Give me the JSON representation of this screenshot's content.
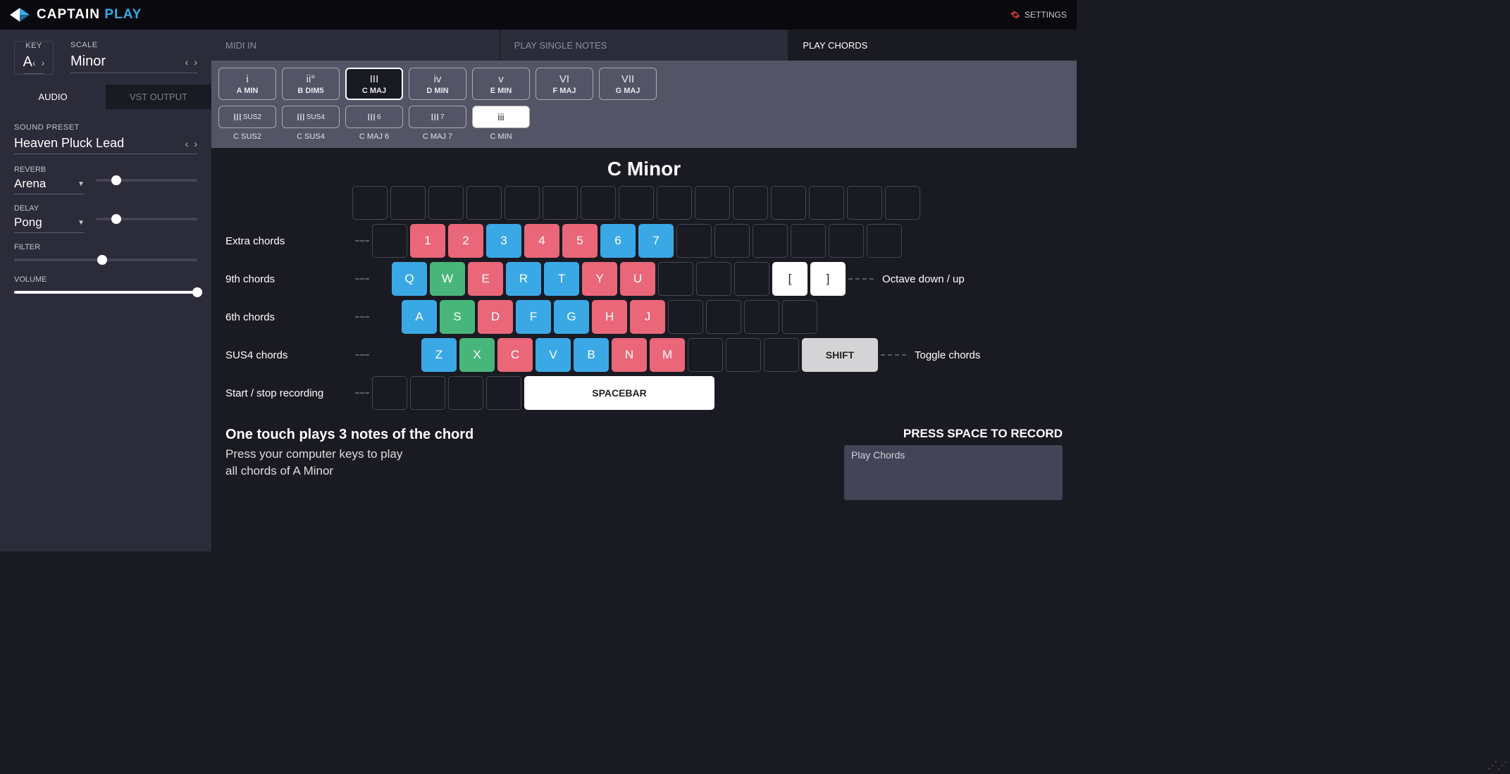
{
  "header": {
    "brand_white": "CAPTAIN",
    "brand_blue": "PLAY",
    "settings": "SETTINGS"
  },
  "sidebar": {
    "key_label": "KEY",
    "key": "A",
    "scale_label": "SCALE",
    "scale": "Minor",
    "tabs": {
      "audio": "AUDIO",
      "vst": "VST OUTPUT"
    },
    "preset_label": "SOUND PRESET",
    "preset": "Heaven Pluck Lead",
    "reverb_label": "REVERB",
    "reverb": "Arena",
    "delay_label": "DELAY",
    "delay": "Pong",
    "filter_label": "FILTER",
    "volume_label": "VOLUME"
  },
  "tabs": {
    "midi": "MIDI IN",
    "single": "PLAY SINGLE NOTES",
    "chords": "PLAY CHORDS"
  },
  "degrees": [
    {
      "sym": "i",
      "name": "A MIN"
    },
    {
      "sym": "ii°",
      "name": "B DIM5"
    },
    {
      "sym": "III",
      "name": "C MAJ",
      "sel": true
    },
    {
      "sym": "iv",
      "name": "D MIN"
    },
    {
      "sym": "v",
      "name": "E MIN"
    },
    {
      "sym": "VI",
      "name": "F MAJ"
    },
    {
      "sym": "VII",
      "name": "G MAJ"
    }
  ],
  "extensions": [
    {
      "sym": "III",
      "sup": "SUS2",
      "cap": "C SUS2"
    },
    {
      "sym": "III",
      "sup": "SUS4",
      "cap": "C SUS4"
    },
    {
      "sym": "III",
      "sup": "6",
      "cap": "C MAJ 6"
    },
    {
      "sym": "III",
      "sup": "7",
      "cap": "C MAJ 7"
    },
    {
      "sym": "iii",
      "sup": "",
      "cap": "C MIN",
      "active": true
    }
  ],
  "chord_title": "C Minor",
  "rows": {
    "extra": {
      "label": "Extra chords",
      "keys": [
        {
          "t": "1",
          "c": "red"
        },
        {
          "t": "2",
          "c": "red"
        },
        {
          "t": "3",
          "c": "blue"
        },
        {
          "t": "4",
          "c": "red"
        },
        {
          "t": "5",
          "c": "red"
        },
        {
          "t": "6",
          "c": "blue"
        },
        {
          "t": "7",
          "c": "blue"
        }
      ]
    },
    "ninth": {
      "label": "9th chords",
      "keys": [
        {
          "t": "Q",
          "c": "blue"
        },
        {
          "t": "W",
          "c": "green"
        },
        {
          "t": "E",
          "c": "red"
        },
        {
          "t": "R",
          "c": "blue"
        },
        {
          "t": "T",
          "c": "blue"
        },
        {
          "t": "Y",
          "c": "red"
        },
        {
          "t": "U",
          "c": "red"
        }
      ],
      "right": "Octave down / up",
      "brackets": [
        "[",
        "]"
      ]
    },
    "sixth": {
      "label": "6th chords",
      "keys": [
        {
          "t": "A",
          "c": "blue"
        },
        {
          "t": "S",
          "c": "green"
        },
        {
          "t": "D",
          "c": "red"
        },
        {
          "t": "F",
          "c": "blue"
        },
        {
          "t": "G",
          "c": "blue"
        },
        {
          "t": "H",
          "c": "red"
        },
        {
          "t": "J",
          "c": "red"
        }
      ]
    },
    "sus4": {
      "label": "SUS4 chords",
      "keys": [
        {
          "t": "Z",
          "c": "blue"
        },
        {
          "t": "X",
          "c": "green"
        },
        {
          "t": "C",
          "c": "red"
        },
        {
          "t": "V",
          "c": "blue"
        },
        {
          "t": "B",
          "c": "blue"
        },
        {
          "t": "N",
          "c": "red"
        },
        {
          "t": "M",
          "c": "red"
        }
      ],
      "shift": "SHIFT",
      "right": "Toggle chords"
    },
    "rec": {
      "label": "Start / stop recording",
      "space": "SPACEBAR"
    }
  },
  "instructions": {
    "title": "One touch plays 3 notes of the chord",
    "line1": "Press your computer keys to play",
    "line2": "all chords of A Minor"
  },
  "record": {
    "title": "PRESS SPACE TO RECORD",
    "box": "Play Chords"
  }
}
